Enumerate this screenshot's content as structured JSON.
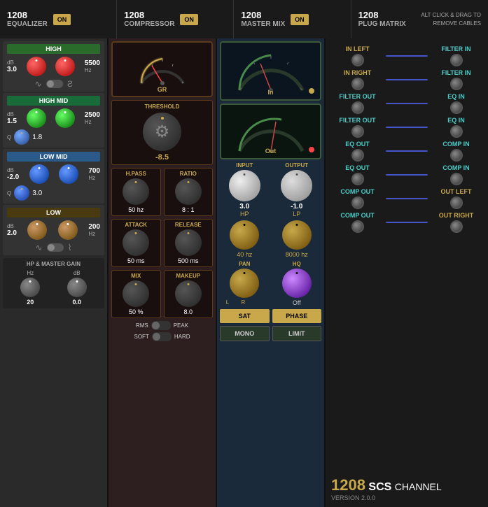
{
  "header": {
    "sections": [
      {
        "id": "eq",
        "number": "1208",
        "name": "EQUALIZER",
        "btn": "ON"
      },
      {
        "id": "comp",
        "number": "1208",
        "name": "COMPRESSOR",
        "btn": "ON"
      },
      {
        "id": "mix",
        "number": "1208",
        "name": "MASTER MIX",
        "btn": "ON"
      },
      {
        "id": "matrix",
        "number": "1208",
        "name": "PLUG MATRIX",
        "alt_text": "ALT CLICK & DRAG TO\nREMOVE CABLES"
      }
    ]
  },
  "eq": {
    "bands": [
      {
        "id": "high",
        "label": "HIGH",
        "db_label": "dB",
        "db_value": "3.0",
        "freq_value": "5500",
        "freq_unit": "Hz",
        "color": "red"
      },
      {
        "id": "high_mid",
        "label": "HIGH MID",
        "db_label": "dB",
        "db_value": "1.5",
        "freq_value": "2500",
        "freq_unit": "Hz",
        "q_value": "1.8",
        "color": "green"
      },
      {
        "id": "low_mid",
        "label": "LOW MID",
        "db_label": "dB",
        "db_value": "-2.0",
        "freq_value": "700",
        "freq_unit": "Hz",
        "q_value": "3.0",
        "color": "blue"
      },
      {
        "id": "low",
        "label": "LOW",
        "db_label": "dB",
        "db_value": "2.0",
        "freq_value": "200",
        "freq_unit": "Hz",
        "color": "brown"
      }
    ],
    "hp_master": {
      "label": "HP & MASTER GAIN",
      "hz_label": "Hz",
      "hz_value": "20",
      "db_label": "dB",
      "db_value": "0.0"
    }
  },
  "compressor": {
    "meter_label": "GR",
    "threshold_label": "THRESHOLD",
    "threshold_value": "-8.5",
    "hpass_label": "H.PASS",
    "ratio_label": "RATIO",
    "hpass_value": "50 hz",
    "ratio_value": "8 : 1",
    "attack_label": "ATTACK",
    "release_label": "RELEASE",
    "attack_value": "50 ms",
    "release_value": "500 ms",
    "mix_label": "MIX",
    "makeup_label": "MAKEUP",
    "mix_value": "50 %",
    "makeup_value": "8.0",
    "rms_label": "RMS",
    "peak_label": "PEAK",
    "soft_label": "SOFT",
    "hard_label": "HARD"
  },
  "mastermix": {
    "in_label": "In",
    "out_label": "Out",
    "input_label": "INPUT",
    "output_label": "OUTPUT",
    "input_value": "3.0",
    "output_value": "-1.0",
    "hp_label": "HP",
    "lp_label": "LP",
    "hp_freq": "40 hz",
    "lp_freq": "8000 hz",
    "pan_label": "PAN",
    "hq_label": "HQ",
    "hq_value": "Off",
    "pan_l": "L",
    "pan_r": "R",
    "sat_label": "SAT",
    "phase_label": "PHASE",
    "mono_label": "MONO",
    "limit_label": "LIMIT"
  },
  "matrix": {
    "rows": [
      {
        "left_label": "IN LEFT",
        "right_label": "FILTER IN",
        "left_color": "yellow",
        "right_color": "teal"
      },
      {
        "left_label": "IN RIGHT",
        "right_label": "FILTER IN",
        "left_color": "yellow",
        "right_color": "teal"
      },
      {
        "left_label": "FILTER OUT",
        "right_label": "EQ IN",
        "left_color": "teal",
        "right_color": "teal"
      },
      {
        "left_label": "FILTER OUT",
        "right_label": "EQ IN",
        "left_color": "teal",
        "right_color": "teal"
      },
      {
        "left_label": "EQ OUT",
        "right_label": "COMP IN",
        "left_color": "teal",
        "right_color": "teal"
      },
      {
        "left_label": "EQ OUT",
        "right_label": "COMP IN",
        "left_color": "teal",
        "right_color": "teal"
      },
      {
        "left_label": "COMP OUT",
        "right_label": "OUT LEFT",
        "left_color": "teal",
        "right_color": "yellow"
      },
      {
        "left_label": "COMP OUT",
        "right_label": "OUT RIGHT",
        "left_color": "teal",
        "right_color": "yellow"
      }
    ],
    "footer": {
      "number": "1208",
      "brand": "SCS",
      "product": "CHANNEL",
      "version": "VERSION 2.0.0"
    }
  }
}
